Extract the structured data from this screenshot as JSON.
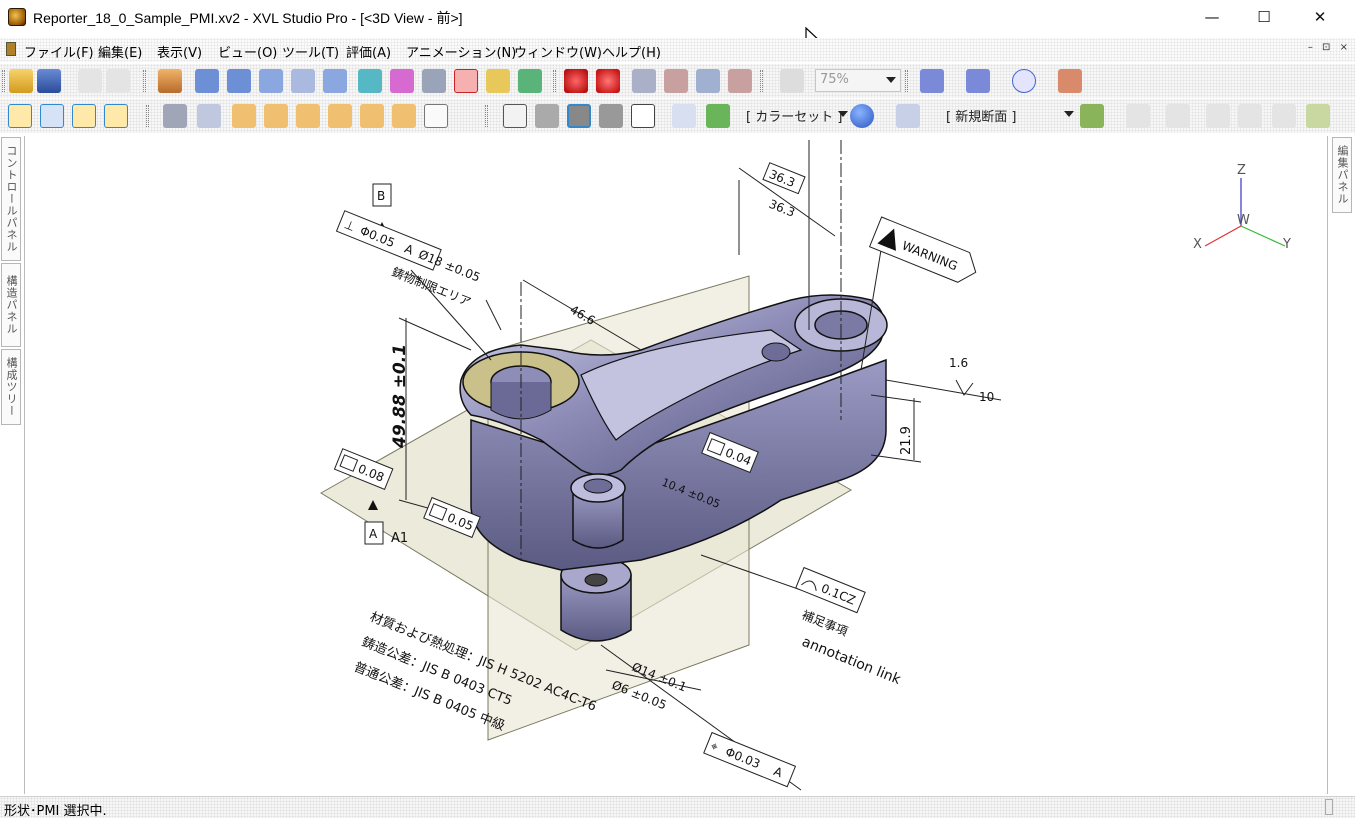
{
  "window": {
    "title": "Reporter_18_0_Sample_PMI.xv2 - XVL Studio Pro - [<3D View - 前>]",
    "minimize": "—",
    "maximize": "☐",
    "close": "✕"
  },
  "menu": {
    "items": [
      "ファイル(F)",
      "編集(E)",
      "表示(V)",
      "ビュー(O)",
      "ツール(T)",
      "評価(A)",
      "アニメーション(N)",
      "ウィンドウ(W)",
      "ヘルプ(H)"
    ],
    "mdi_controls": "– ⊡ ×"
  },
  "toolbar": {
    "zoom_value": "75%",
    "color_set": "[ カラーセット ]",
    "section": "[ 新規断面 ]"
  },
  "side_panels": {
    "left": [
      "コントロールパネル",
      "構造パネル",
      "構成ツリー"
    ],
    "right": [
      "編集パネル"
    ]
  },
  "axes": {
    "z": "Z",
    "x": "X",
    "y": "Y",
    "w": "W"
  },
  "pmi": {
    "datum_b": "B",
    "fcf_perp": {
      "symbol": "⊥",
      "value": "Φ0.05",
      "datum": "A"
    },
    "dia18": "Ø18 ±0.05",
    "area_label": "鋳物制限エリア",
    "dim_46_6": "46.6",
    "dim_36_3a": "36.3",
    "dim_36_3b": "36.3",
    "warning": "WARNING",
    "rough_1_6": "1.6",
    "rough_10": "10",
    "dim_21_9": "21.9",
    "dim_49_88": "49.88 ±0.1",
    "flat_0_08": "0.08",
    "datum_a": "A",
    "datum_a1": "A1",
    "flat_0_05": "0.05",
    "flat_0_04": "0.04",
    "dim_10_4": "10.4 ±0.05",
    "prof_value": "0.1CZ",
    "note_supp": "補足事項",
    "annotation_link": "annotation link",
    "dia14": "Ø14 ±0.1",
    "dia6": "Ø6 ±0.05",
    "pos_value": "Φ0.03",
    "pos_datum": "A",
    "note1": "材質および熱処理：JIS H 5202 AC4C-T6",
    "note2": "鋳造公差：JIS B 0403 CT5",
    "note3": "普通公差：JIS B 0405 中級"
  },
  "status": {
    "text": "形状･PMI 選択中."
  },
  "colors": {
    "part": "#7d7ca3",
    "face_highlight": "#c9c08a",
    "plane": "#e3e0cc"
  }
}
